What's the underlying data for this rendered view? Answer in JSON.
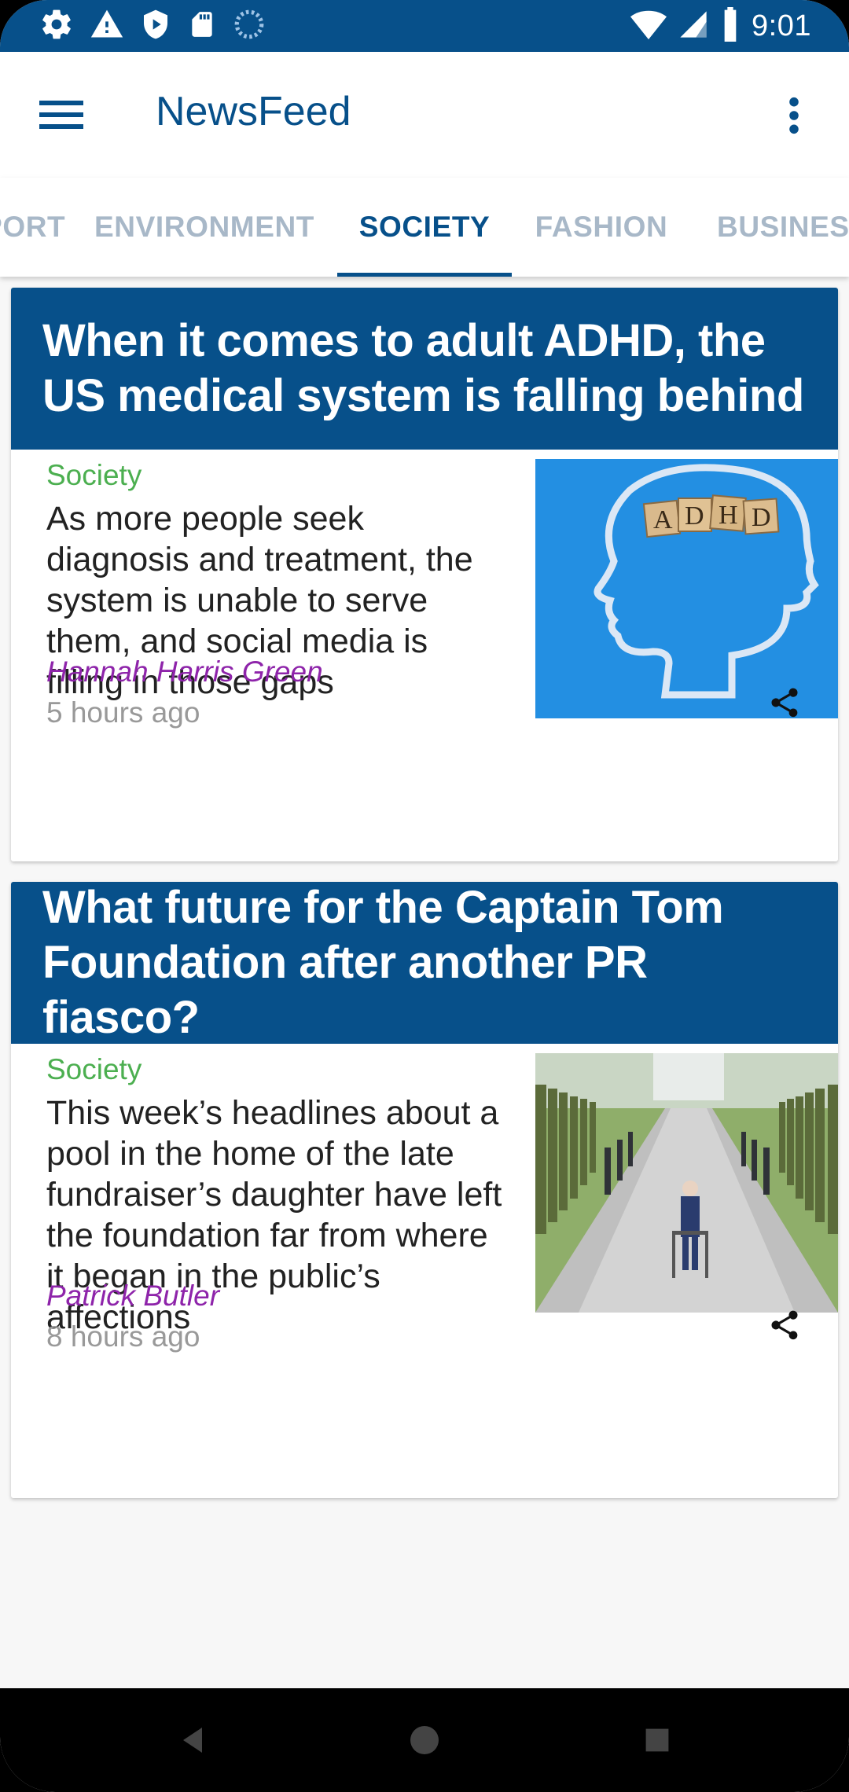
{
  "status_bar": {
    "time": "9:01",
    "left_icons": [
      "settings-icon",
      "warning-icon",
      "shield-play-icon",
      "sd-card-icon",
      "loading-icon"
    ],
    "right_icons": [
      "wifi-icon",
      "cellular-icon",
      "battery-icon"
    ]
  },
  "app_bar": {
    "title": "NewsFeed",
    "menu_icon": "hamburger-menu-icon",
    "overflow_icon": "more-vert-icon"
  },
  "tabs": {
    "items": [
      {
        "label": "SPORT"
      },
      {
        "label": "ENVIRONMENT"
      },
      {
        "label": "SOCIETY"
      },
      {
        "label": "FASHION"
      },
      {
        "label": "BUSINESS"
      }
    ],
    "selected": "SOCIETY"
  },
  "articles": [
    {
      "title": "When it comes to adult ADHD, the US medical system is falling behind",
      "section": "Society",
      "summary": "As more people seek diagnosis and treatment, the system is unable to serve them, and social media is filling in those gaps",
      "author": "Hannah Harris Green",
      "time": "5 hours ago",
      "image_text": "ADHD",
      "image_desc_icon": "head-silhouette-with-adhd-blocks"
    },
    {
      "title": "What future for the Captain Tom Foundation after another PR fiasco?",
      "section": "Society",
      "summary": "This week’s headlines about a pool in the home of the late fundraiser’s daughter have left the foundation far from where it began in the public’s affections",
      "author": "Patrick Butler",
      "time": "8 hours ago",
      "image_desc_icon": "man-with-walker-between-soldiers"
    }
  ],
  "colors": {
    "primary": "#07508a",
    "section": "#4caf50",
    "author": "#8e24aa",
    "tab_inactive": "#a8b8c8"
  }
}
